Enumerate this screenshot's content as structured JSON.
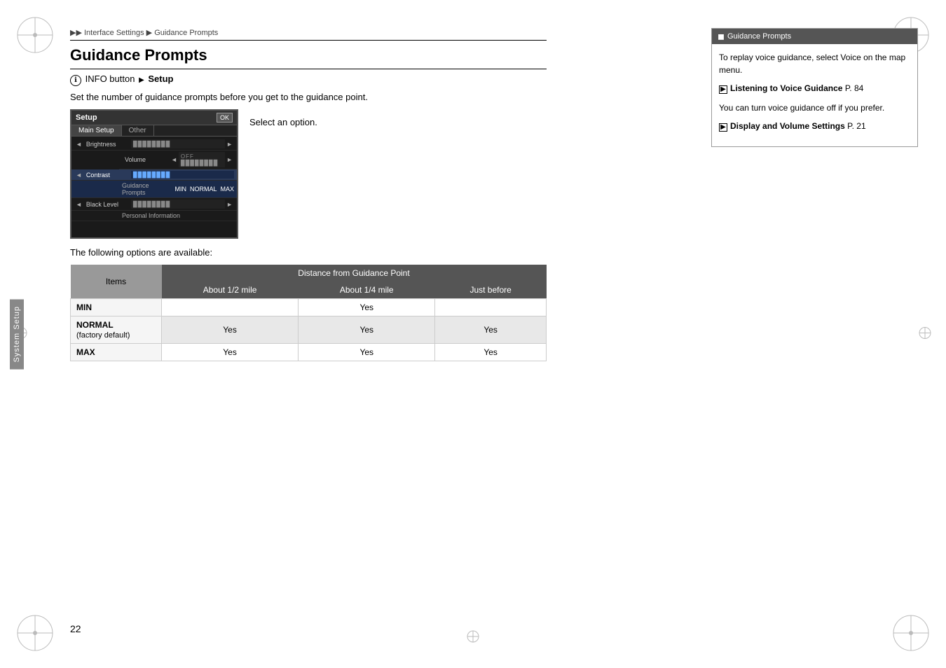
{
  "page": {
    "number": "22",
    "background": "#ffffff"
  },
  "breadcrumb": {
    "items": [
      "",
      "Interface Settings",
      "Guidance Prompts"
    ],
    "separator": "▶"
  },
  "title": "Guidance Prompts",
  "info_line": {
    "icon": "ℹ",
    "text": "INFO button",
    "arrow": "▶",
    "bold_text": "Setup"
  },
  "description": "Set the number of guidance prompts before you get to the guidance point.",
  "select_option": "Select an option.",
  "following_text": "The following options are available:",
  "setup_screen": {
    "title": "Setup",
    "ok": "OK",
    "tab1": "Main Setup",
    "tab2": "Other",
    "rows": [
      {
        "label": "Brightness",
        "value": "████████",
        "has_nav": true
      },
      {
        "label": "Volume",
        "value": "OFF ████████",
        "has_nav": true
      },
      {
        "label": "Contrast",
        "value": "████████",
        "has_nav": true,
        "sub": "Guidance Prompts",
        "sub_value": "MIN NORMAL MAX"
      },
      {
        "label": "Black Level",
        "value": "████████",
        "has_nav": true,
        "sub2": "Personal Information"
      }
    ]
  },
  "table": {
    "header_item": "Items",
    "header_distance": "Distance from Guidance Point",
    "col1": "About 1/2 mile",
    "col2": "About 1/4 mile",
    "col3": "Just before",
    "rows": [
      {
        "item": "MIN",
        "item_sub": "",
        "col1": "",
        "col2": "Yes",
        "col3": ""
      },
      {
        "item": "NORMAL",
        "item_sub": "(factory default)",
        "col1": "Yes",
        "col2": "Yes",
        "col3": "Yes"
      },
      {
        "item": "MAX",
        "item_sub": "",
        "col1": "Yes",
        "col2": "Yes",
        "col3": "Yes"
      }
    ]
  },
  "sidebar": {
    "label": "System Setup"
  },
  "right_panel": {
    "header_icon": "◼",
    "header_text": "Guidance Prompts",
    "para1": "To replay voice guidance, select Voice on the map menu.",
    "ref1_icon": "▶",
    "ref1_bold": "Listening to Voice Guidance",
    "ref1_page": "P. 84",
    "para2": "You can turn voice guidance off if you prefer.",
    "ref2_icon": "▶",
    "ref2_bold": "Display and Volume Settings",
    "ref2_page": "P. 21"
  }
}
